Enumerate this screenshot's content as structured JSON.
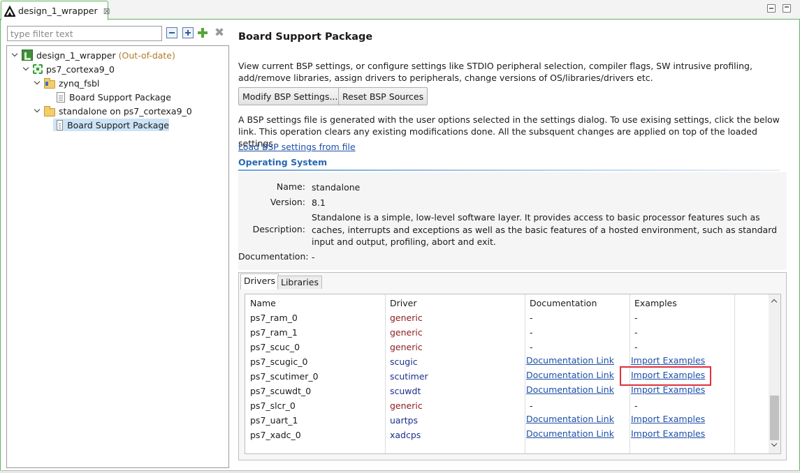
{
  "editor_tab": {
    "title": "design_1_wrapper",
    "close": "⊠"
  },
  "filter": {
    "placeholder": "type filter text"
  },
  "tree": {
    "project": {
      "label": "design_1_wrapper",
      "status": "(Out-of-date)"
    },
    "cpu": {
      "label": "ps7_cortexa9_0"
    },
    "fsbl": {
      "label": "zynq_fsbl",
      "child": "Board Support Package"
    },
    "standalone": {
      "label": "standalone on ps7_cortexa9_0",
      "child": "Board Support Package"
    }
  },
  "main": {
    "title": "Board Support Package",
    "intro": "View current BSP settings, or configure settings like STDIO peripheral selection, compiler flags, SW intrusive profiling, add/remove libraries, assign drivers to peripherals, change versions of OS/libraries/drivers etc.",
    "modify_button": "Modify BSP Settings...",
    "reset_button": "Reset BSP Sources",
    "settings_note": "A BSP settings file is generated with the user options selected in the settings dialog. To use exising settings, click the below link. This operation clears any existing modifications done. All the subsquent changes are applied on top of the loaded settings.",
    "load_link": "Load BSP settings from file"
  },
  "os": {
    "section_title": "Operating System",
    "name_label": "Name:",
    "name_value": "standalone",
    "version_label": "Version:",
    "version_value": "8.1",
    "description_label": "Description:",
    "description_value": "Standalone is a simple, low-level software layer. It provides access to basic processor features such as caches, interrupts and exceptions as well as the basic features of a hosted environment, such as standard input and output, profiling, abort and exit.",
    "documentation_label": "Documentation:",
    "documentation_value": "-"
  },
  "tabs": {
    "drivers": "Drivers",
    "libraries": "Libraries"
  },
  "table": {
    "headers": {
      "name": "Name",
      "driver": "Driver",
      "documentation": "Documentation",
      "examples": "Examples"
    },
    "rows": [
      {
        "name": "ps7_ram_0",
        "driver": "generic",
        "doc": "-",
        "examples": "-"
      },
      {
        "name": "ps7_ram_1",
        "driver": "generic",
        "doc": "-",
        "examples": "-"
      },
      {
        "name": "ps7_scuc_0",
        "driver": "generic",
        "doc": "-",
        "examples": "-"
      },
      {
        "name": "ps7_scugic_0",
        "driver": "scugic",
        "doc": "Documentation Link",
        "examples": "Import Examples"
      },
      {
        "name": "ps7_scutimer_0",
        "driver": "scutimer",
        "doc": "Documentation Link",
        "examples": "Import Examples"
      },
      {
        "name": "ps7_scuwdt_0",
        "driver": "scuwdt",
        "doc": "Documentation Link",
        "examples": "Import Examples"
      },
      {
        "name": "ps7_slcr_0",
        "driver": "generic",
        "doc": "-",
        "examples": "-"
      },
      {
        "name": "ps7_uart_1",
        "driver": "uartps",
        "doc": "Documentation Link",
        "examples": "Import Examples"
      },
      {
        "name": "ps7_xadc_0",
        "driver": "xadcps",
        "doc": "Documentation Link",
        "examples": "Import Examples"
      }
    ]
  },
  "colors": {
    "accent_green": "#64b464",
    "link_blue": "#1c4fa8",
    "highlight_red": "#e0303a",
    "generic_driver": "#8a1c1c",
    "named_driver": "#1b2f8a"
  }
}
